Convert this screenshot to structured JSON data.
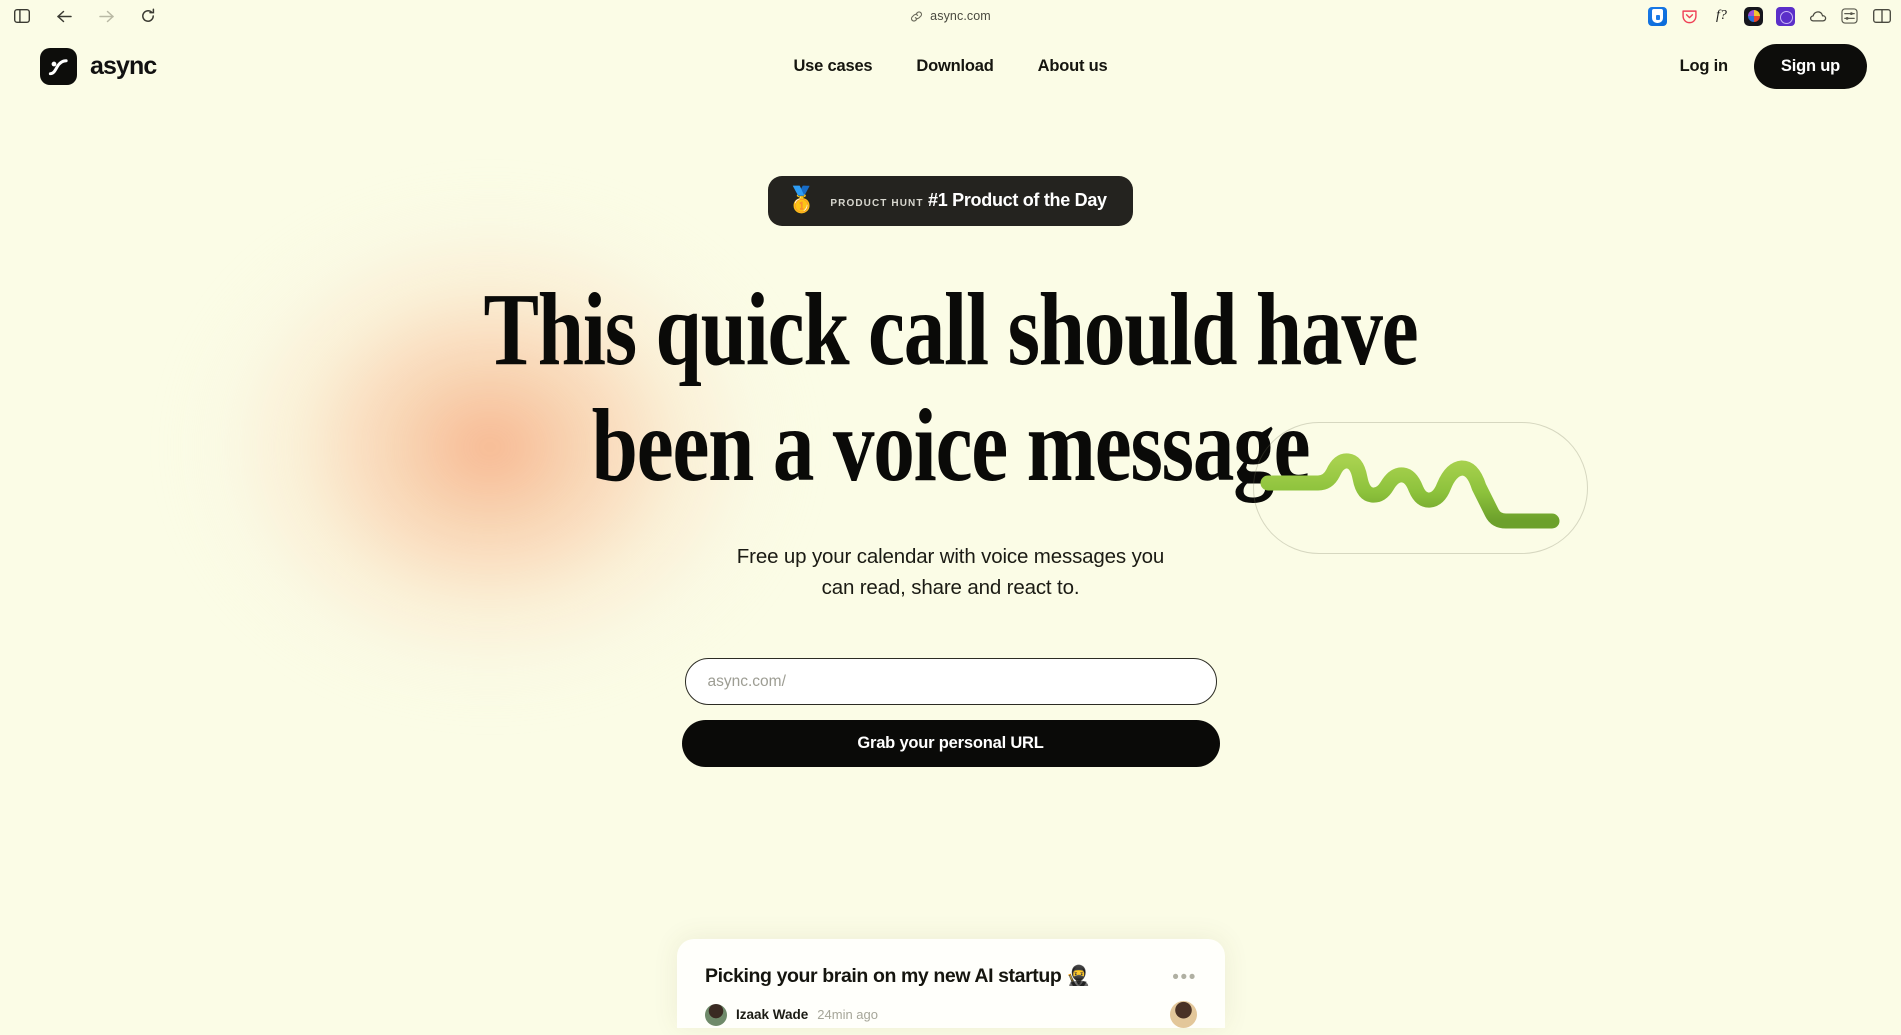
{
  "browser": {
    "url": "async.com",
    "nav": {
      "sidebar_toggle": "sidebar-toggle",
      "back": "back",
      "forward": "forward",
      "reload": "reload"
    },
    "extensions": [
      {
        "name": "1password-extension",
        "label": "1Password"
      },
      {
        "name": "pocket-extension",
        "label": "Pocket"
      },
      {
        "name": "fmath-extension",
        "label": "f?"
      },
      {
        "name": "colorful-extension",
        "label": "Color wheel"
      },
      {
        "name": "purple-globe-extension",
        "label": "Globe"
      },
      {
        "name": "cloud-extension",
        "label": "Cloud"
      },
      {
        "name": "sliders-extension",
        "label": "Settings"
      },
      {
        "name": "split-view-extension",
        "label": "Split view"
      }
    ]
  },
  "header": {
    "brand": "async",
    "nav_items": [
      {
        "label": "Use cases"
      },
      {
        "label": "Download"
      },
      {
        "label": "About us"
      }
    ],
    "login_label": "Log in",
    "signup_label": "Sign up"
  },
  "hero": {
    "badge": {
      "medal": "🥇",
      "kicker": "PRODUCT HUNT",
      "title": "#1 Product of the Day"
    },
    "headline_line1": "This quick call should have",
    "headline_line2": "been a voice message",
    "subheading_line1": "Free up your calendar with voice messages you",
    "subheading_line2": "can read, share and react to.",
    "input_placeholder": "async.com/",
    "input_value": "",
    "cta_label": "Grab your personal URL"
  },
  "message_card": {
    "title": "Picking your brain on my new AI startup 🥷",
    "author": "Izaak Wade",
    "time": "24min ago",
    "menu": "•••"
  },
  "colors": {
    "page_bg": "#fbfce6",
    "ink": "#0a0a08",
    "glow": "#f5a073",
    "wave_green": "#8cc63f",
    "badge_bg": "#24231f"
  }
}
